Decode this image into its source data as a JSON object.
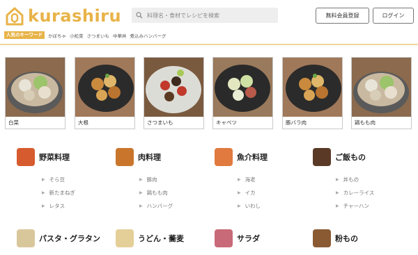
{
  "header": {
    "logo_text": "kurashiru",
    "search_placeholder": "料理名・食材でレシピを検索",
    "register_label": "無料会員登録",
    "login_label": "ログイン"
  },
  "keywords": {
    "badge": "人気のキーワード",
    "items": [
      "かぼちゃ",
      "小松菜",
      "さつまいも",
      "中華丼",
      "煮込みハンバーグ"
    ]
  },
  "featured": [
    {
      "label": "白菜"
    },
    {
      "label": "大根"
    },
    {
      "label": "さつまいも"
    },
    {
      "label": "キャベツ"
    },
    {
      "label": "豚バラ肉"
    },
    {
      "label": "鶏もも肉"
    }
  ],
  "categories": [
    {
      "title": "野菜料理",
      "subs": [
        "そら豆",
        "新たまねぎ",
        "レタス"
      ]
    },
    {
      "title": "肉料理",
      "subs": [
        "豚肉",
        "鶏もも肉",
        "ハンバーグ"
      ]
    },
    {
      "title": "魚介料理",
      "subs": [
        "海老",
        "イカ",
        "いわし"
      ]
    },
    {
      "title": "ご飯もの",
      "subs": [
        "丼もの",
        "カレーライス",
        "チャーハン"
      ]
    },
    {
      "title": "パスタ・グラタン",
      "subs": []
    },
    {
      "title": "うどん・蕎麦",
      "subs": []
    },
    {
      "title": "サラダ",
      "subs": []
    },
    {
      "title": "粉もの",
      "subs": []
    }
  ],
  "colors": {
    "brand": "#e8b348"
  }
}
